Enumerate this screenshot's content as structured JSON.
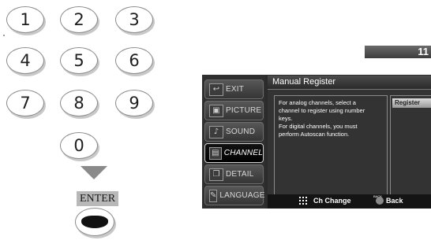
{
  "remote": {
    "keys": [
      "1",
      "2",
      "3",
      "4",
      "5",
      "6",
      "7",
      "8",
      "9",
      "0"
    ],
    "enter_label": "ENTER"
  },
  "channel_indicator": {
    "number": "11"
  },
  "menu": {
    "nav": [
      {
        "label": "EXIT",
        "icon": "exit-arrow-icon"
      },
      {
        "label": "PICTURE",
        "icon": "picture-icon"
      },
      {
        "label": "SOUND",
        "icon": "music-note-icon"
      },
      {
        "label": "CHANNEL",
        "icon": "tv-screen-icon"
      },
      {
        "label": "DETAIL",
        "icon": "detail-pages-icon"
      },
      {
        "label": "LANGUAGE",
        "icon": "language-icon"
      }
    ],
    "active": "CHANNEL",
    "title": "Manual Register",
    "message": [
      "For analog channels, select a",
      "channel to register using number",
      "keys.",
      "For digital channels, you must",
      "perform Autoscan function."
    ],
    "register_label": "Register",
    "hints": {
      "ch_change": "Ch Change",
      "back_tiny": "BACK",
      "back": "Back"
    },
    "colors": {
      "panel": "#333333",
      "nav_active_border": "#d0d0d0"
    }
  }
}
